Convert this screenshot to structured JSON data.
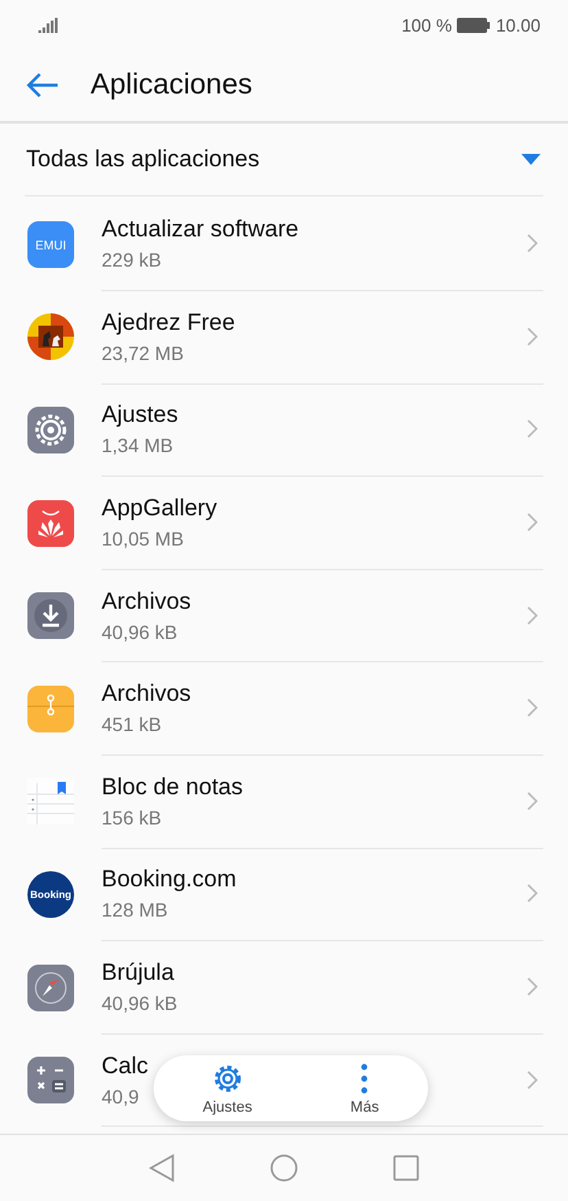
{
  "status_bar": {
    "battery": "100 %",
    "time": "10.00"
  },
  "header": {
    "title": "Aplicaciones"
  },
  "filter": {
    "label": "Todas las aplicaciones"
  },
  "apps": [
    {
      "name": "Actualizar software",
      "size": "229 kB",
      "kind": "emui",
      "icon_label": "EMUI"
    },
    {
      "name": "Ajedrez Free",
      "size": "23,72 MB",
      "kind": "chess"
    },
    {
      "name": "Ajustes",
      "size": "1,34 MB",
      "kind": "settings"
    },
    {
      "name": "AppGallery",
      "size": "10,05 MB",
      "kind": "gallery"
    },
    {
      "name": "Archivos",
      "size": "40,96 kB",
      "kind": "download"
    },
    {
      "name": "Archivos",
      "size": "451 kB",
      "kind": "folder"
    },
    {
      "name": "Bloc de notas",
      "size": "156 kB",
      "kind": "notes"
    },
    {
      "name": "Booking.com",
      "size": "128 MB",
      "kind": "booking",
      "icon_label": "Booking"
    },
    {
      "name": "Brújula",
      "size": "40,96 kB",
      "kind": "compass"
    },
    {
      "name": "Calc",
      "size": "40,9",
      "kind": "calculator"
    }
  ],
  "toolbar": [
    {
      "label": "Ajustes",
      "kind": "gear"
    },
    {
      "label": "Más",
      "kind": "more"
    }
  ]
}
